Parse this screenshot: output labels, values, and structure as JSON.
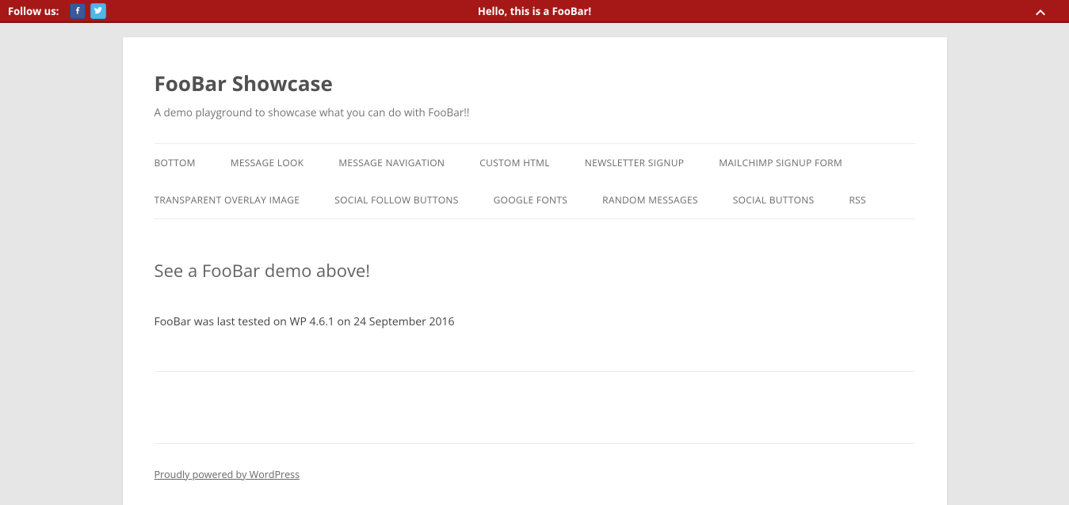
{
  "foobar": {
    "follow_label": "Follow us:",
    "message": "Hello, this is a FooBar!"
  },
  "header": {
    "title": "FooBar Showcase",
    "tagline": "A demo playground to showcase what you can do with FooBar!!"
  },
  "nav": {
    "items": [
      "BOTTOM",
      "MESSAGE LOOK",
      "MESSAGE NAVIGATION",
      "CUSTOM HTML",
      "NEWSLETTER SIGNUP",
      "MAILCHIMP SIGNUP FORM",
      "TRANSPARENT OVERLAY IMAGE",
      "SOCIAL FOLLOW BUTTONS",
      "GOOGLE FONTS",
      "RANDOM MESSAGES",
      "SOCIAL BUTTONS",
      "RSS"
    ]
  },
  "content": {
    "heading": "See a FooBar demo above!",
    "text": "FooBar was last tested on WP 4.6.1 on 24 September 2016"
  },
  "footer": {
    "credit": "Proudly powered by WordPress"
  }
}
